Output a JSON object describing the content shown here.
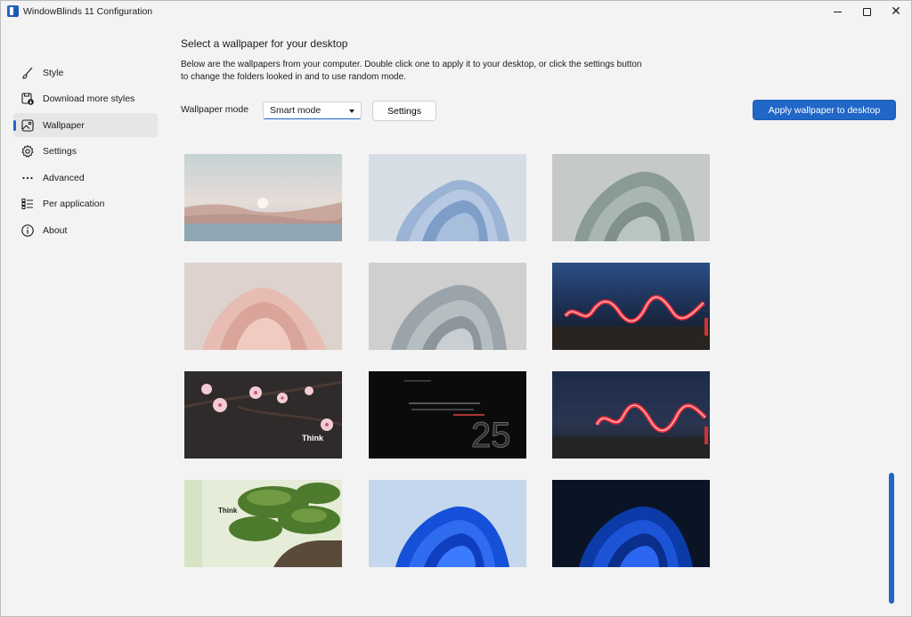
{
  "window": {
    "title": "WindowBlinds 11 Configuration"
  },
  "sidebar": {
    "items": [
      {
        "label": "Style",
        "icon": "brush-icon",
        "active": false
      },
      {
        "label": "Download more styles",
        "icon": "download-icon",
        "active": false
      },
      {
        "label": "Wallpaper",
        "icon": "image-icon",
        "active": true
      },
      {
        "label": "Settings",
        "icon": "gear-icon",
        "active": false
      },
      {
        "label": "Advanced",
        "icon": "more-icon",
        "active": false
      },
      {
        "label": "Per application",
        "icon": "list-icon",
        "active": false
      },
      {
        "label": "About",
        "icon": "info-icon",
        "active": false
      }
    ]
  },
  "main": {
    "heading": "Select a wallpaper for your desktop",
    "description": "Below are the wallpapers from your computer.  Double click one to apply it to your desktop, or click the settings button to change the folders looked in and to use random mode.",
    "mode_label": "Wallpaper mode",
    "mode_value": "Smart mode",
    "settings_label": "Settings",
    "apply_label": "Apply wallpaper to desktop"
  },
  "wallpapers": [
    {
      "name": "sunset-lake"
    },
    {
      "name": "bloom-light-blue"
    },
    {
      "name": "bloom-sage"
    },
    {
      "name": "bloom-pink"
    },
    {
      "name": "bloom-gray"
    },
    {
      "name": "light-trail-beach"
    },
    {
      "name": "cherry-blossom",
      "overlay_text": "Think"
    },
    {
      "name": "quote-25",
      "overlay_text": "25"
    },
    {
      "name": "light-trail-night"
    },
    {
      "name": "pine-tree",
      "overlay_text": "Think"
    },
    {
      "name": "bloom-blue-light"
    },
    {
      "name": "bloom-blue-dark"
    }
  ],
  "colors": {
    "accent": "#1f67c9"
  }
}
